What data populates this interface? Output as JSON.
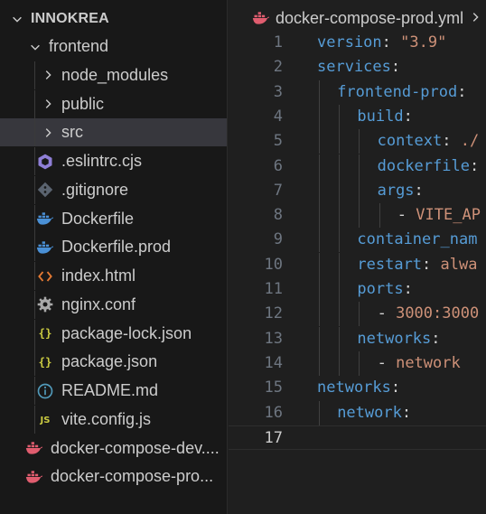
{
  "explorer": {
    "root": "INNOKREA",
    "items": [
      {
        "label": "frontend",
        "depth": 1,
        "kind": "folder",
        "open": true,
        "icon": "chevron-down-icon"
      },
      {
        "label": "node_modules",
        "depth": 2,
        "kind": "folder",
        "open": false,
        "icon": "chevron-right-icon"
      },
      {
        "label": "public",
        "depth": 2,
        "kind": "folder",
        "open": false,
        "icon": "chevron-right-icon"
      },
      {
        "label": "src",
        "depth": 2,
        "kind": "folder",
        "open": false,
        "selected": true,
        "icon": "chevron-right-icon"
      },
      {
        "label": ".eslintrc.cjs",
        "depth": 2,
        "kind": "file",
        "icon": "eslint-icon",
        "color": "#8f7fd6"
      },
      {
        "label": ".gitignore",
        "depth": 2,
        "kind": "file",
        "icon": "git-icon",
        "color": "#5b6470"
      },
      {
        "label": "Dockerfile",
        "depth": 2,
        "kind": "file",
        "icon": "docker-icon",
        "color": "#4a90d6"
      },
      {
        "label": "Dockerfile.prod",
        "depth": 2,
        "kind": "file",
        "icon": "docker-icon",
        "color": "#4a90d6"
      },
      {
        "label": "index.html",
        "depth": 2,
        "kind": "file",
        "icon": "html-icon",
        "color": "#e37933"
      },
      {
        "label": "nginx.conf",
        "depth": 2,
        "kind": "file",
        "icon": "gear-icon",
        "color": "#a9a9a9"
      },
      {
        "label": "package-lock.json",
        "depth": 2,
        "kind": "file",
        "icon": "json-icon",
        "color": "#cbcb41"
      },
      {
        "label": "package.json",
        "depth": 2,
        "kind": "file",
        "icon": "json-icon",
        "color": "#cbcb41"
      },
      {
        "label": "README.md",
        "depth": 2,
        "kind": "file",
        "icon": "info-icon",
        "color": "#519aba"
      },
      {
        "label": "vite.config.js",
        "depth": 2,
        "kind": "file",
        "icon": "js-icon",
        "color": "#cbcb41"
      },
      {
        "label": "docker-compose-dev....",
        "depth": 1,
        "kind": "file",
        "icon": "docker-compose-icon",
        "color": "#e05d6f"
      },
      {
        "label": "docker-compose-pro...",
        "depth": 1,
        "kind": "file",
        "icon": "docker-compose-icon",
        "color": "#e05d6f"
      }
    ]
  },
  "editor": {
    "tab": {
      "label": "docker-compose-prod.yml",
      "icon": "docker-compose-icon",
      "color": "#e05d6f"
    },
    "active_line": 17,
    "lines": [
      {
        "n": "1",
        "indent": 0,
        "tokens": [
          {
            "t": "version",
            "c": "k"
          },
          {
            "t": ": ",
            "c": "p"
          },
          {
            "t": "\"3.9\"",
            "c": "s"
          }
        ]
      },
      {
        "n": "2",
        "indent": 0,
        "tokens": [
          {
            "t": "services",
            "c": "k"
          },
          {
            "t": ":",
            "c": "p"
          }
        ]
      },
      {
        "n": "3",
        "indent": 1,
        "tokens": [
          {
            "t": "frontend-prod",
            "c": "k"
          },
          {
            "t": ":",
            "c": "p"
          }
        ]
      },
      {
        "n": "4",
        "indent": 2,
        "tokens": [
          {
            "t": "build",
            "c": "k"
          },
          {
            "t": ":",
            "c": "p"
          }
        ]
      },
      {
        "n": "5",
        "indent": 3,
        "tokens": [
          {
            "t": "context",
            "c": "k"
          },
          {
            "t": ": ",
            "c": "p"
          },
          {
            "t": "./",
            "c": "s"
          }
        ]
      },
      {
        "n": "6",
        "indent": 3,
        "tokens": [
          {
            "t": "dockerfile",
            "c": "k"
          },
          {
            "t": ":",
            "c": "p"
          }
        ]
      },
      {
        "n": "7",
        "indent": 3,
        "tokens": [
          {
            "t": "args",
            "c": "k"
          },
          {
            "t": ":",
            "c": "p"
          }
        ]
      },
      {
        "n": "8",
        "indent": 4,
        "tokens": [
          {
            "t": "- ",
            "c": "p"
          },
          {
            "t": "VITE_AP",
            "c": "s"
          }
        ]
      },
      {
        "n": "9",
        "indent": 2,
        "tokens": [
          {
            "t": "container_nam",
            "c": "k"
          }
        ]
      },
      {
        "n": "10",
        "indent": 2,
        "tokens": [
          {
            "t": "restart",
            "c": "k"
          },
          {
            "t": ": ",
            "c": "p"
          },
          {
            "t": "alwa",
            "c": "s"
          }
        ]
      },
      {
        "n": "11",
        "indent": 2,
        "tokens": [
          {
            "t": "ports",
            "c": "k"
          },
          {
            "t": ":",
            "c": "p"
          }
        ]
      },
      {
        "n": "12",
        "indent": 3,
        "tokens": [
          {
            "t": "- ",
            "c": "p"
          },
          {
            "t": "3000:3000",
            "c": "s"
          }
        ]
      },
      {
        "n": "13",
        "indent": 2,
        "tokens": [
          {
            "t": "networks",
            "c": "k"
          },
          {
            "t": ":",
            "c": "p"
          }
        ]
      },
      {
        "n": "14",
        "indent": 3,
        "tokens": [
          {
            "t": "- ",
            "c": "p"
          },
          {
            "t": "network",
            "c": "s"
          }
        ]
      },
      {
        "n": "15",
        "indent": 0,
        "tokens": [
          {
            "t": "networks",
            "c": "k"
          },
          {
            "t": ":",
            "c": "p"
          }
        ]
      },
      {
        "n": "16",
        "indent": 1,
        "tokens": [
          {
            "t": "network",
            "c": "k"
          },
          {
            "t": ":",
            "c": "p"
          }
        ]
      },
      {
        "n": "17",
        "indent": 0,
        "tokens": []
      }
    ]
  }
}
